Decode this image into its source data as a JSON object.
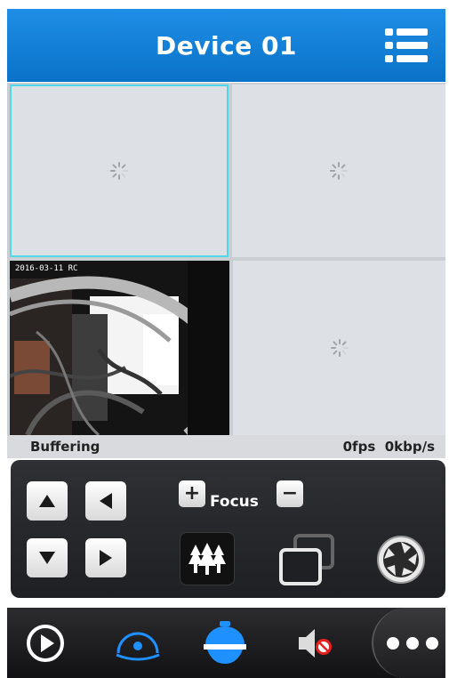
{
  "header": {
    "title": "Device 01",
    "menu_icon": "list-menu-icon"
  },
  "video_grid": {
    "tiles": [
      {
        "position": "top-left",
        "state": "loading",
        "selected": true
      },
      {
        "position": "top-right",
        "state": "loading",
        "selected": false
      },
      {
        "position": "bottom-left",
        "state": "playing",
        "overlay": "2016-03-11 RC",
        "selected": false
      },
      {
        "position": "bottom-right",
        "state": "loading",
        "selected": false
      }
    ]
  },
  "status": {
    "state": "Buffering",
    "rate": "0fps  0kbp/s"
  },
  "ptz": {
    "focus_label": "Focus",
    "focus_plus": "+",
    "focus_minus": "−",
    "directions": [
      "up-arrow-icon",
      "left-arrow-icon",
      "down-arrow-icon",
      "right-arrow-icon"
    ],
    "tools": [
      "forest-icon",
      "multi-window-icon",
      "aperture-icon"
    ]
  },
  "bottom_bar": {
    "items": [
      "play-icon",
      "dome-camera-icon",
      "ptz-camera-icon",
      "speaker-muted-icon",
      "more-icon"
    ],
    "accent": "#1e90ff"
  }
}
